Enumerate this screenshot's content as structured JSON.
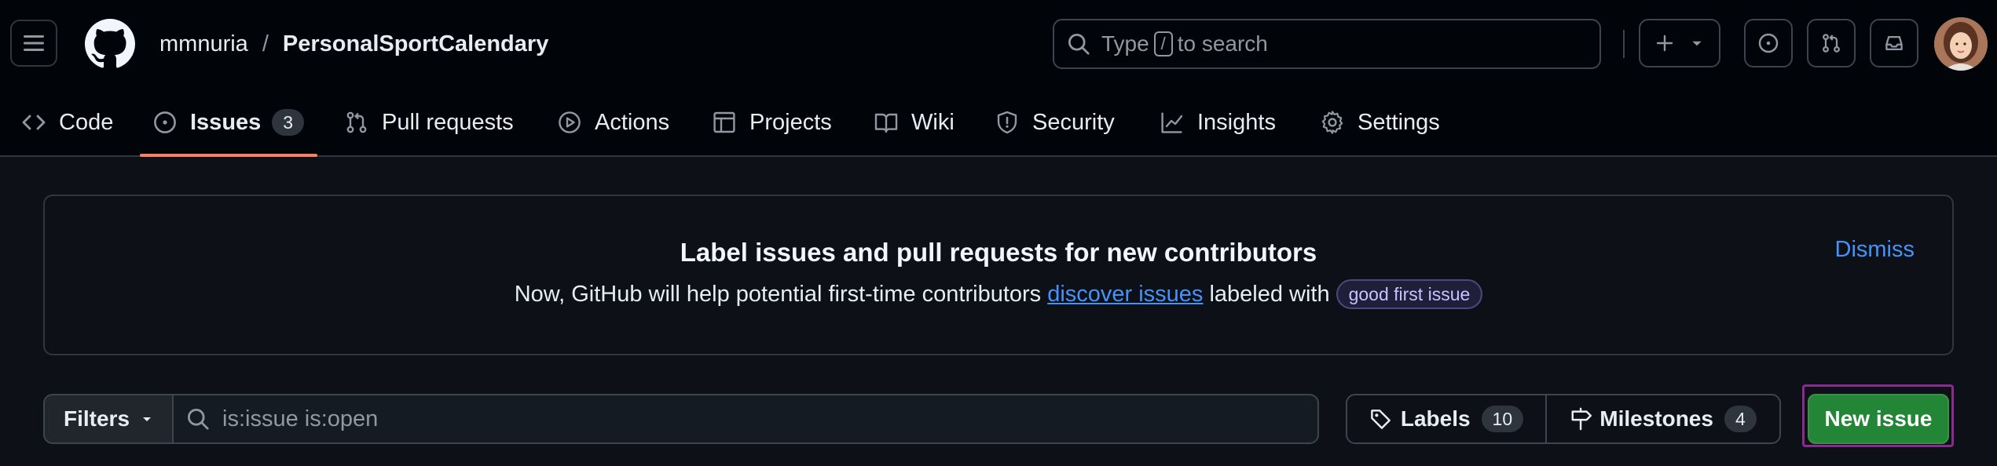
{
  "header": {
    "owner": "mmnuria",
    "separator": "/",
    "repo": "PersonalSportCalendary",
    "search": {
      "prefix": "Type",
      "key": "/",
      "suffix": "to search"
    }
  },
  "tabs": [
    {
      "id": "code",
      "label": "Code",
      "icon": "code-icon"
    },
    {
      "id": "issues",
      "label": "Issues",
      "icon": "issue-opened-icon",
      "count": "3",
      "active": true
    },
    {
      "id": "pull-requests",
      "label": "Pull requests",
      "icon": "git-pull-request-icon"
    },
    {
      "id": "actions",
      "label": "Actions",
      "icon": "play-icon"
    },
    {
      "id": "projects",
      "label": "Projects",
      "icon": "table-icon"
    },
    {
      "id": "wiki",
      "label": "Wiki",
      "icon": "book-icon"
    },
    {
      "id": "security",
      "label": "Security",
      "icon": "shield-icon"
    },
    {
      "id": "insights",
      "label": "Insights",
      "icon": "graph-icon"
    },
    {
      "id": "settings",
      "label": "Settings",
      "icon": "gear-icon"
    }
  ],
  "banner": {
    "title": "Label issues and pull requests for new contributors",
    "text_before": "Now, GitHub will help potential first-time contributors",
    "link": "discover issues",
    "text_after": "labeled with",
    "label": "good first issue",
    "dismiss": "Dismiss"
  },
  "toolbar": {
    "filters": "Filters",
    "search_value": "is:issue is:open",
    "labels": "Labels",
    "labels_count": "10",
    "milestones": "Milestones",
    "milestones_count": "4",
    "new_issue": "New issue"
  },
  "colors": {
    "background": "#0d1117",
    "header_bg": "#010409",
    "accent_underline": "#f78166",
    "link": "#4493f8",
    "primary_button": "#238636",
    "highlight_outline": "#8a2b8f"
  }
}
